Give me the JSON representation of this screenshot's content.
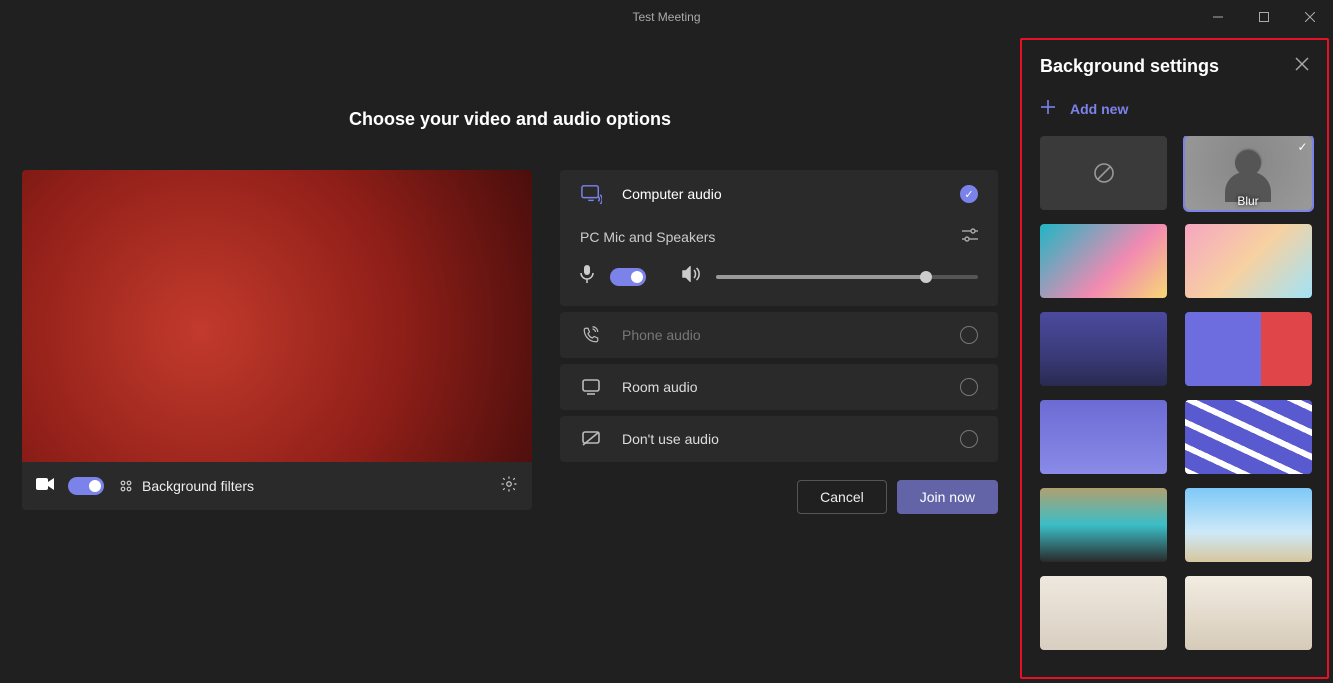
{
  "window": {
    "title": "Test Meeting"
  },
  "main": {
    "heading": "Choose your video and audio options",
    "video": {
      "background_filters_label": "Background filters"
    },
    "audio": {
      "computer_label": "Computer audio",
      "device_label": "PC Mic and Speakers",
      "phone_label": "Phone audio",
      "room_label": "Room audio",
      "none_label": "Don't use audio",
      "selected": "computer",
      "volume_pct": 80
    },
    "buttons": {
      "cancel": "Cancel",
      "join": "Join now"
    }
  },
  "side": {
    "title": "Background settings",
    "add_new": "Add new",
    "thumbs": {
      "none": "",
      "blur": "Blur"
    },
    "selected": "blur"
  }
}
